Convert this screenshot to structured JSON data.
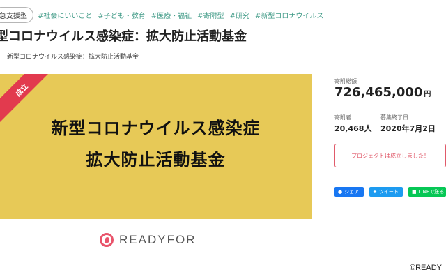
{
  "tags": {
    "badge": "急支援型",
    "items": [
      "#社会にいいこと",
      "#子ども・教育",
      "#医療・福祉",
      "#寄附型",
      "#研究",
      "#新型コロナウイルス"
    ]
  },
  "project": {
    "title": "型コロナウイルス感染症：拡大防止活動基金",
    "subtitle": "新型コロナウイルス感染症：拡大防止活動基金"
  },
  "hero": {
    "ribbon": "成立",
    "line1": "新型コロナウイルス感染症",
    "line2": "拡大防止活動基金",
    "logo": "READYFOR"
  },
  "stats": {
    "total_label": "寄附総額",
    "total_value": "726,465,000",
    "total_unit": "円",
    "donors_label": "寄附者",
    "donors_value": "20,468人",
    "end_label": "募集終了日",
    "end_value": "2020年7月2日"
  },
  "status_message": "プロジェクトは成立しました！",
  "share": {
    "facebook": "シェア",
    "twitter": "ツイート",
    "line": "LINEで送る"
  },
  "copyright": "©READY",
  "colors": {
    "hero_bg": "#e7c957",
    "ribbon": "#e23a4e",
    "tag_text": "#3f9a86",
    "status_border": "#e05a6a"
  }
}
